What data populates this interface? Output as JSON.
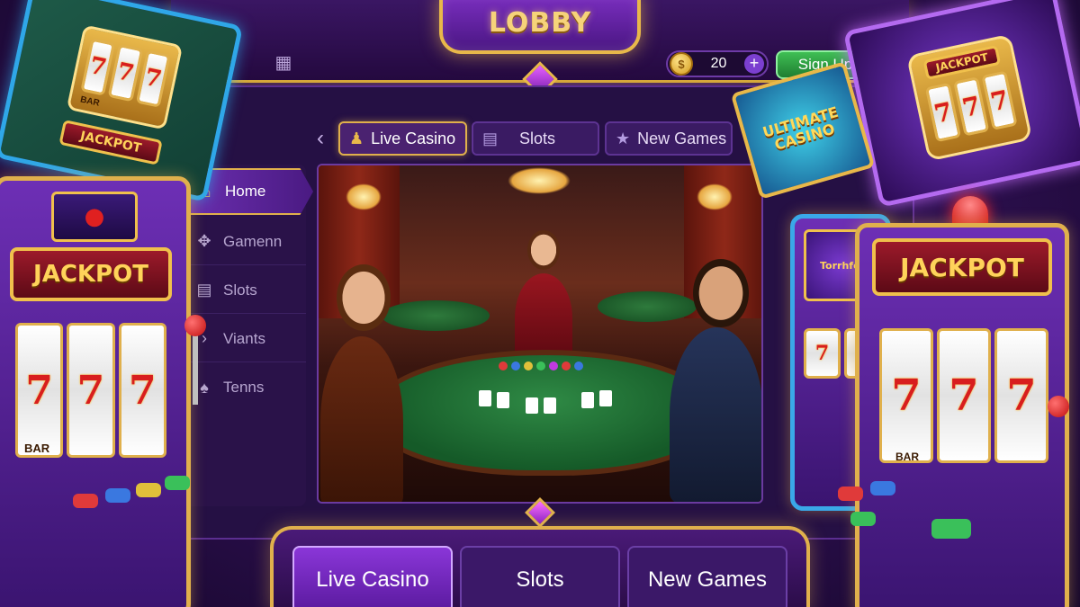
{
  "header": {
    "title": "LOBBY",
    "coins": "20",
    "coin_symbol": "$",
    "plus_label": "+",
    "signup_label": "Sign Up"
  },
  "top_tabs": [
    {
      "label": "Live Casino",
      "icon": "dealer-icon",
      "active": true
    },
    {
      "label": "Slots",
      "icon": "slot-machine-icon",
      "active": false
    },
    {
      "label": "New Games",
      "icon": "star-icon",
      "active": false
    }
  ],
  "sidebar": {
    "items": [
      {
        "label": "Home",
        "icon": "home-icon",
        "active": true
      },
      {
        "label": "Gamenn",
        "icon": "gamepad-icon",
        "active": false
      },
      {
        "label": "Slots",
        "icon": "slot-machine-icon",
        "active": false
      },
      {
        "label": "Viants",
        "icon": "chevron-icon",
        "active": false
      },
      {
        "label": "Tenns",
        "icon": "spade-icon",
        "active": false
      }
    ]
  },
  "bottom_nav": [
    {
      "label": "Live Casino",
      "active": true
    },
    {
      "label": "Slots",
      "active": false
    },
    {
      "label": "New Games",
      "active": false
    }
  ],
  "decor": {
    "jackpot_top_left": "JACKPOT",
    "bar_top_left": "BAR",
    "jackpot_left": "JACKPOT",
    "bar_left": "BAR",
    "reel_symbol": "7",
    "jackpot_top_right": "JACKPOT",
    "ultimate_casino": "ULTIMATE\nCASINO",
    "jackpot_right": "JACKPOT",
    "bar_right": "BAR",
    "small_machine_sign": "Torrhfer"
  },
  "colors": {
    "gold": "#e0b04c",
    "purple_bg": "#2c0f4e",
    "signup_green": "#3fbf54",
    "felt_green": "#2f8a45"
  }
}
